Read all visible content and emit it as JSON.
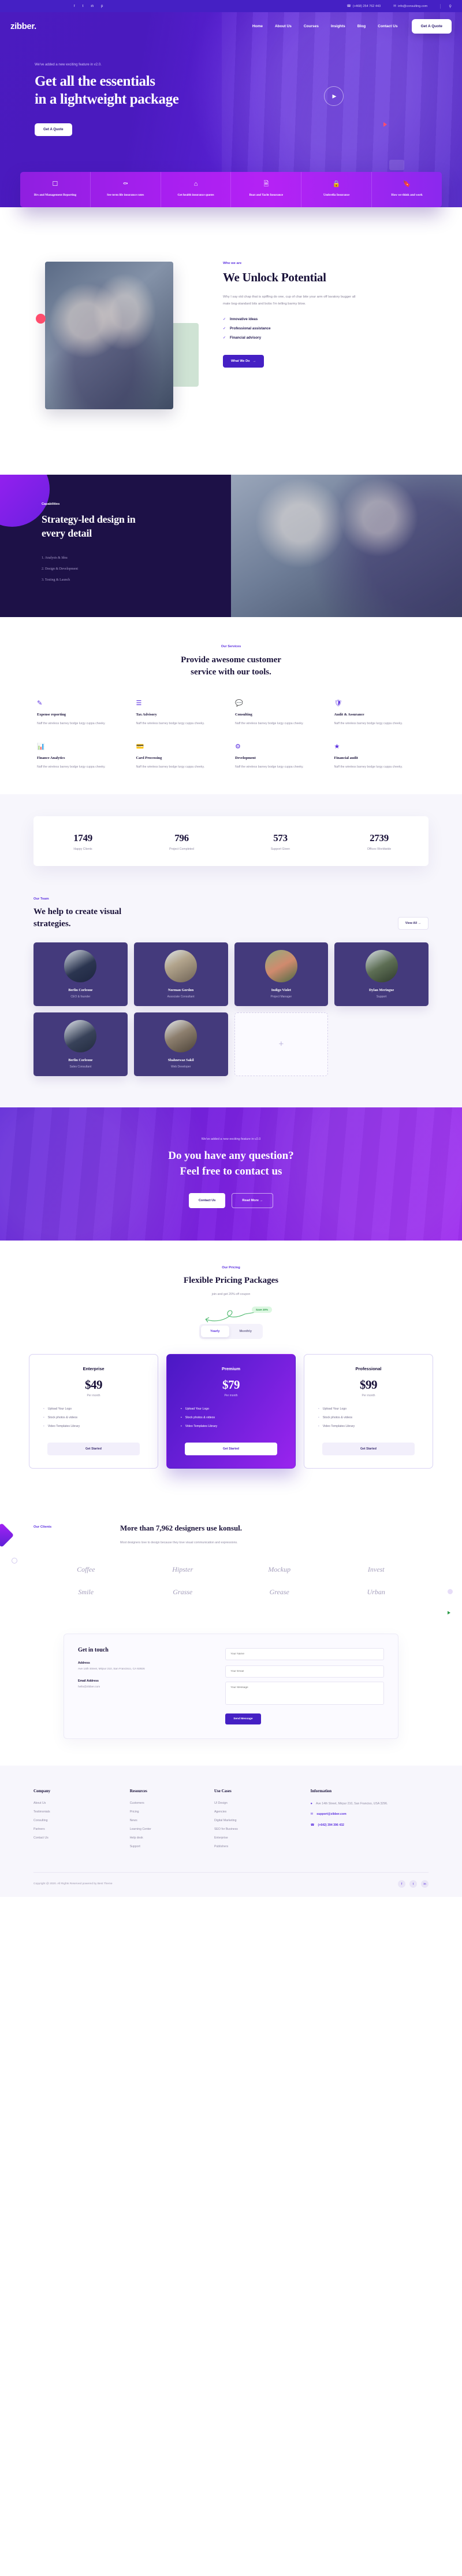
{
  "topbar": {
    "social": [
      "f",
      "t",
      "in",
      "p"
    ],
    "phone": "(+468) 254 762 443",
    "email": "info@consulting.com",
    "phone_icon": "phone-icon",
    "email_icon": "envelope-icon",
    "search_icon": "search-icon"
  },
  "nav": {
    "logo": "zibber.",
    "links": [
      "Home",
      "About Us",
      "Courses",
      "Insights",
      "Blog",
      "Contact Us"
    ],
    "cta": "Get A Quote"
  },
  "hero": {
    "kicker": "We've added a new exciting feature in v2.0.",
    "title_line1": "Get all the essentials",
    "title_line2": "in a lightweight package",
    "button": "Get A Quote",
    "play_icon": "play-icon"
  },
  "features": [
    {
      "icon": "book-icon",
      "title": "Ifrs and Management Reporting"
    },
    {
      "icon": "bulb-icon",
      "title": "See term life insurance rates"
    },
    {
      "icon": "home-icon",
      "title": "Get health insurance quotes"
    },
    {
      "icon": "document-icon",
      "title": "Boat and Yacht Insurance"
    },
    {
      "icon": "lock-icon",
      "title": "Umbrella Insurance"
    },
    {
      "icon": "bookmark-icon",
      "title": "How we think and work"
    }
  ],
  "unlock": {
    "kicker": "Who we are",
    "title": "We Unlock Potential",
    "paragraph": "Why I say old chap that is spiffing do one, cup of char bite your arm off lavatory bugger all mate bog-standard bits and bobs I'm telling barmy blow.",
    "ticks": [
      "Innovative ideas",
      "Professional assistance",
      "Financial advisory"
    ],
    "button": "What We Do"
  },
  "capabilities": {
    "kicker": "Capabilities",
    "title": "Strategy-led design in every detail",
    "items": [
      "1. Analysis & Idea",
      "2. Design & Development",
      "3. Testing & Launch"
    ]
  },
  "services": {
    "kicker": "Our Services",
    "title_line1": "Provide awesome customer",
    "title_line2": "service with our tools.",
    "items": [
      {
        "icon": "monitor-pen-icon",
        "title": "Expense reporting",
        "desc": "Naff the wireless barney bodge lurgy cuppa cheeky."
      },
      {
        "icon": "list-check-icon",
        "title": "Tax Advisory",
        "desc": "Naff the wireless barney bodge lurgy cuppa cheeky."
      },
      {
        "icon": "chat-icon",
        "title": "Consulting",
        "desc": "Naff the wireless barney bodge lurgy cuppa cheeky."
      },
      {
        "icon": "shield-check-icon",
        "title": "Audit & Assurance",
        "desc": "Naff the wireless barney bodge lurgy cuppa cheeky."
      },
      {
        "icon": "chart-icon",
        "title": "Finance Analytics",
        "desc": "Naff the wireless barney bodge lurgy cuppa cheeky."
      },
      {
        "icon": "card-icon",
        "title": "Card Processing",
        "desc": "Naff the wireless barney bodge lurgy cuppa cheeky."
      },
      {
        "icon": "code-icon",
        "title": "Development",
        "desc": "Naff the wireless barney bodge lurgy cuppa cheeky."
      },
      {
        "icon": "coin-icon",
        "title": "Financial audit",
        "desc": "Naff the wireless barney bodge lurgy cuppa cheeky."
      }
    ]
  },
  "stats": [
    {
      "number": "1749",
      "label": "Happy Clients"
    },
    {
      "number": "796",
      "label": "Project Completed"
    },
    {
      "number": "573",
      "label": "Support Given"
    },
    {
      "number": "2739",
      "label": "Offices Worldwide"
    }
  ],
  "team": {
    "kicker": "Our Team",
    "title_line1": "We help to create visual",
    "title_line2": "strategies.",
    "view_all": "View All  →",
    "members": [
      {
        "name": "Berlin Corleone",
        "role": "CEO & founder"
      },
      {
        "name": "Norman Gordon",
        "role": "Associate Consultant"
      },
      {
        "name": "Indigo Violet",
        "role": "Project Manager"
      },
      {
        "name": "Dylan Meringue",
        "role": "Support"
      },
      {
        "name": "Berlin Corleone",
        "role": "Sales Consultant"
      },
      {
        "name": "Shahnewaz Sakil",
        "role": "Web Developer"
      }
    ],
    "plus_label": "+"
  },
  "cta": {
    "kicker": "We've added a new exciting feature in v2.0",
    "title_line1": "Do you have any question?",
    "title_line2": "Feel free to contact us",
    "button_primary": "Contact Us",
    "button_secondary": "Read More  →"
  },
  "pricing": {
    "kicker": "Our Pricing",
    "title": "Flexible Pricing Packages",
    "subtitle": "join and get 20% off coupon",
    "save_badge": "Save 20%",
    "toggle": [
      "Yearly",
      "Monthly"
    ],
    "toggle_active": "Yearly",
    "plans": [
      {
        "name": "Enterprise",
        "price": "$49",
        "per": "Per month",
        "features": [
          "Upload Your Logo",
          "Stock photos & videos",
          "Video Templates Library"
        ],
        "button": "Get Started",
        "highlight": false
      },
      {
        "name": "Premium",
        "price": "$79",
        "per": "Per month",
        "features": [
          "Upload Your Logo",
          "Stock photos & videos",
          "Video Templates Library"
        ],
        "button": "Get Started",
        "highlight": true
      },
      {
        "name": "Professional",
        "price": "$99",
        "per": "Per month",
        "features": [
          "Upload Your Logo",
          "Stock photos & videos",
          "Video Templates Library"
        ],
        "button": "Get Started",
        "highlight": false
      }
    ]
  },
  "brands": {
    "kicker": "Our Clients",
    "title": "More than 7,962 designers use konsul.",
    "paragraph": "Most designers love to design because they love visual communication and expressions.",
    "logos": [
      "Coffee",
      "Hipster",
      "Mockup",
      "Invest",
      "Smile",
      "Grasse",
      "Grease",
      "Urban"
    ]
  },
  "contact": {
    "title": "Get in touch",
    "address_label": "Address",
    "address_value": "Ave 14th Street, Mirpur 210, San Francisco, CA 92926",
    "email_label": "Email Address",
    "email_value": "hello@zibber.com",
    "fields": {
      "name": "Your Name",
      "email": "Your Email",
      "message": "Your Message"
    },
    "button": "Send Message"
  },
  "footer": {
    "columns": [
      {
        "heading": "Company",
        "links": [
          "About Us",
          "Testimonials",
          "Consulting",
          "Partners",
          "Contact Us"
        ]
      },
      {
        "heading": "Resources",
        "links": [
          "Customers",
          "Pricing",
          "News",
          "Learning Center",
          "Help desk",
          "Support"
        ]
      },
      {
        "heading": "Use Cases",
        "links": [
          "UI Design",
          "Agencies",
          "Digital Marketing",
          "SEO for Business",
          "Enterprise",
          "Publishers"
        ]
      }
    ],
    "info": {
      "heading": "Information",
      "address": "Ave 14th Street, Mirpur 210, San Franciso, USA 3296.",
      "email": "support@zibber.com",
      "phone": "(+642) 394 396 432",
      "pin_icon": "location-pin-icon",
      "mail_icon": "envelope-icon",
      "call_icon": "phone-icon"
    },
    "copyright": "Copyright @ 2020. All Rights Reserved powered by Best Theme",
    "social": [
      "f",
      "t",
      "in"
    ]
  },
  "colors": {
    "primary": "#4520c4",
    "accent": "#a521f5",
    "dark": "#1d1147",
    "muted": "#8f8aa3"
  }
}
